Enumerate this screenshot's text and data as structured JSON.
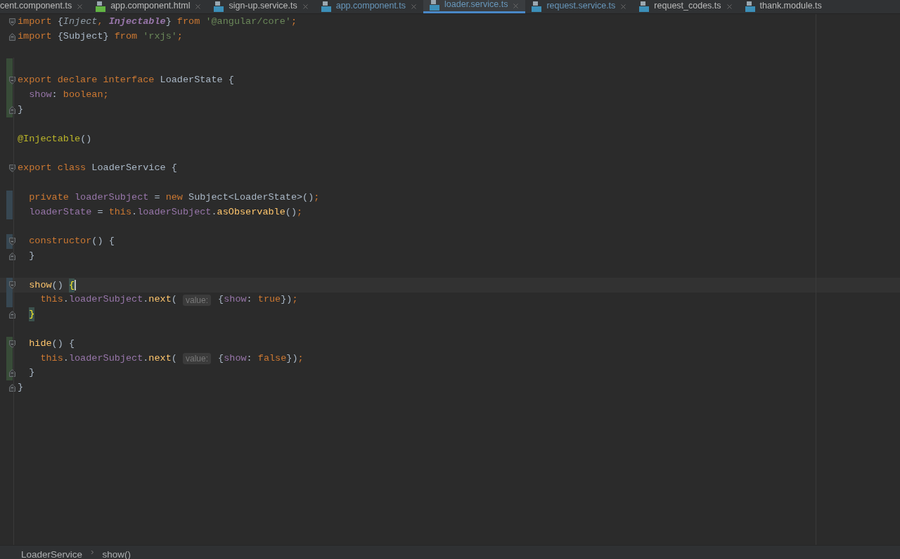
{
  "tabs": [
    {
      "label": "cent.component.ts",
      "selected": false,
      "modified": false,
      "closable": true
    },
    {
      "label": "app.component.html",
      "kind": "html",
      "selected": false,
      "modified": false,
      "closable": true
    },
    {
      "label": "sign-up.service.ts",
      "kind": "ts",
      "selected": false,
      "modified": false,
      "closable": true
    },
    {
      "label": "app.component.ts",
      "kind": "ts",
      "selected": false,
      "modified": true,
      "closable": true
    },
    {
      "label": "loader.service.ts",
      "kind": "ts",
      "selected": true,
      "modified": true,
      "closable": true
    },
    {
      "label": "request.service.ts",
      "kind": "ts",
      "selected": false,
      "modified": true,
      "closable": true
    },
    {
      "label": "request_codes.ts",
      "kind": "ts",
      "selected": false,
      "modified": false,
      "closable": true
    },
    {
      "label": "thank.module.ts",
      "kind": "ts",
      "selected": false,
      "modified": false,
      "closable": false
    }
  ],
  "editor": {
    "lines": [
      {
        "fold_start": true,
        "tokens": [
          {
            "kind": "keyword",
            "text": "import "
          },
          {
            "kind": "plain",
            "text": "{"
          },
          {
            "kind": "param",
            "text": "Inject"
          },
          {
            "kind": "keyword",
            "text": ", "
          },
          {
            "kind": "decorator_ref",
            "text": "Injectable"
          },
          {
            "kind": "plain",
            "text": "} "
          },
          {
            "kind": "keyword",
            "text": "from "
          },
          {
            "kind": "string",
            "text": "'@angular/core'"
          },
          {
            "kind": "keyword",
            "text": ";"
          }
        ]
      },
      {
        "fold_end": true,
        "tokens": [
          {
            "kind": "keyword",
            "text": "import "
          },
          {
            "kind": "plain",
            "text": "{Subject} "
          },
          {
            "kind": "keyword",
            "text": "from "
          },
          {
            "kind": "string",
            "text": "'rxjs'"
          },
          {
            "kind": "keyword",
            "text": ";"
          }
        ]
      },
      {
        "kind": "blank"
      },
      {
        "added": true
      },
      {
        "added": true,
        "fold_start": true,
        "tokens": [
          {
            "kind": "keyword",
            "text": "export declare interface "
          },
          {
            "kind": "plain",
            "text": "LoaderState {"
          }
        ]
      },
      {
        "added": true,
        "tokens": [
          {
            "kind": "field",
            "text": "  show"
          },
          {
            "kind": "plain",
            "text": ": "
          },
          {
            "kind": "keyword",
            "text": "boolean;"
          }
        ]
      },
      {
        "added": true,
        "fold_end": true,
        "tokens": [
          {
            "kind": "plain",
            "text": "}"
          }
        ]
      },
      {
        "kind": "blank"
      },
      {
        "tokens": [
          {
            "kind": "decorator",
            "text": "@Injectable"
          },
          {
            "kind": "plain",
            "text": "()"
          }
        ]
      },
      {
        "kind": "blank"
      },
      {
        "fold_start": true,
        "tokens": [
          {
            "kind": "keyword",
            "text": "export class "
          },
          {
            "kind": "plain",
            "text": "LoaderService {"
          }
        ]
      },
      {
        "kind": "blank"
      },
      {
        "modified": true,
        "tokens": [
          {
            "kind": "keyword",
            "text": "  private "
          },
          {
            "kind": "field",
            "text": "loaderSubject"
          },
          {
            "kind": "plain",
            "text": " = "
          },
          {
            "kind": "keyword",
            "text": "new "
          },
          {
            "kind": "plain",
            "text": "Subject<LoaderState>()"
          },
          {
            "kind": "keyword",
            "text": ";"
          }
        ]
      },
      {
        "modified": true,
        "tokens": [
          {
            "kind": "field",
            "text": "  loaderState"
          },
          {
            "kind": "plain",
            "text": " = "
          },
          {
            "kind": "keyword",
            "text": "this"
          },
          {
            "kind": "plain",
            "text": "."
          },
          {
            "kind": "field",
            "text": "loaderSubject"
          },
          {
            "kind": "plain",
            "text": "."
          },
          {
            "kind": "function",
            "text": "asObservable"
          },
          {
            "kind": "plain",
            "text": "()"
          },
          {
            "kind": "keyword",
            "text": ";"
          }
        ]
      },
      {
        "kind": "blank"
      },
      {
        "modified": true,
        "fold_start": true,
        "tokens": [
          {
            "kind": "keyword",
            "text": "  constructor"
          },
          {
            "kind": "plain",
            "text": "() {"
          }
        ]
      },
      {
        "fold_end": true,
        "tokens": [
          {
            "kind": "plain",
            "text": "  }"
          }
        ]
      },
      {
        "kind": "blank"
      },
      {
        "modified": true,
        "fold_start": true,
        "current": true,
        "caret": true,
        "tokens": [
          {
            "kind": "function",
            "text": "  show"
          },
          {
            "kind": "plain",
            "text": "() "
          },
          {
            "kind": "brace_match",
            "text": "{"
          }
        ]
      },
      {
        "modified": true,
        "tokens": [
          {
            "kind": "keyword",
            "text": "    this"
          },
          {
            "kind": "plain",
            "text": "."
          },
          {
            "kind": "field",
            "text": "loaderSubject"
          },
          {
            "kind": "plain",
            "text": "."
          },
          {
            "kind": "function",
            "text": "next"
          },
          {
            "kind": "plain",
            "text": "( "
          },
          {
            "kind": "hint",
            "text": "value:"
          },
          {
            "kind": "plain",
            "text": " {"
          },
          {
            "kind": "field",
            "text": "show"
          },
          {
            "kind": "plain",
            "text": ": "
          },
          {
            "kind": "keyword",
            "text": "true"
          },
          {
            "kind": "plain",
            "text": "})"
          },
          {
            "kind": "keyword",
            "text": ";"
          }
        ]
      },
      {
        "fold_end": true,
        "indented": true,
        "tokens": [
          {
            "kind": "brace_match",
            "text": "}"
          }
        ]
      },
      {
        "kind": "blank"
      },
      {
        "added": true,
        "fold_start": true,
        "tokens": [
          {
            "kind": "function",
            "text": "  hide"
          },
          {
            "kind": "plain",
            "text": "() {"
          }
        ]
      },
      {
        "added": true,
        "tokens": [
          {
            "kind": "keyword",
            "text": "    this"
          },
          {
            "kind": "plain",
            "text": "."
          },
          {
            "kind": "field",
            "text": "loaderSubject"
          },
          {
            "kind": "plain",
            "text": "."
          },
          {
            "kind": "function",
            "text": "next"
          },
          {
            "kind": "plain",
            "text": "( "
          },
          {
            "kind": "hint",
            "text": "value:"
          },
          {
            "kind": "plain",
            "text": " {"
          },
          {
            "kind": "field",
            "text": "show"
          },
          {
            "kind": "plain",
            "text": ": "
          },
          {
            "kind": "keyword",
            "text": "false"
          },
          {
            "kind": "plain",
            "text": "})"
          },
          {
            "kind": "keyword",
            "text": ";"
          }
        ]
      },
      {
        "added": true,
        "fold_end": true,
        "tokens": [
          {
            "kind": "plain",
            "text": "  }"
          }
        ]
      },
      {
        "fold_end": true,
        "tokens": [
          {
            "kind": "plain",
            "text": "}"
          }
        ]
      }
    ]
  },
  "breadcrumbs": {
    "items": [
      "LoaderService",
      "show()"
    ],
    "separator": "›"
  }
}
